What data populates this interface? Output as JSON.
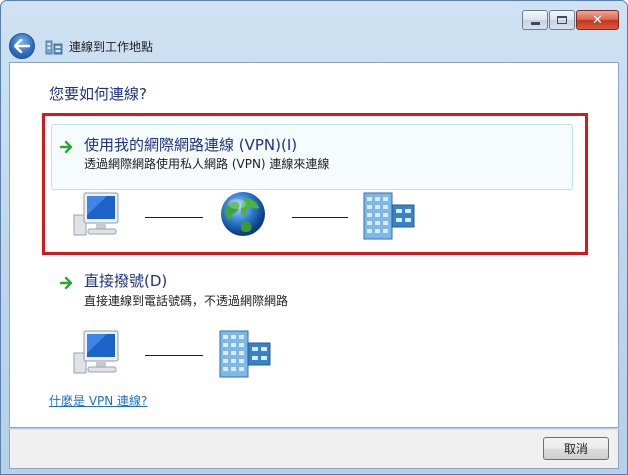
{
  "window": {
    "title": "連線到工作地點",
    "caption": {
      "minimize": "minimize",
      "maximize": "maximize",
      "close": "✕"
    }
  },
  "main": {
    "question": "您要如何連線?",
    "options": [
      {
        "title": "使用我的網際網路連線 (VPN)(I)",
        "description": "透過網際網路使用私人網路 (VPN) 連線來連線",
        "diagram": [
          "computer-icon",
          "globe-icon",
          "building-icon"
        ]
      },
      {
        "title": "直接撥號(D)",
        "description": "直接連線到電話號碼，不透過網際網路",
        "diagram": [
          "computer-icon",
          "building-icon"
        ]
      }
    ],
    "help_link": "什麼是 VPN 連線?"
  },
  "footer": {
    "cancel_label": "取消"
  },
  "colors": {
    "heading": "#1e3287",
    "link": "#1c6fd1",
    "highlight_border": "#d8161b",
    "arrow": "#2fa52f"
  }
}
